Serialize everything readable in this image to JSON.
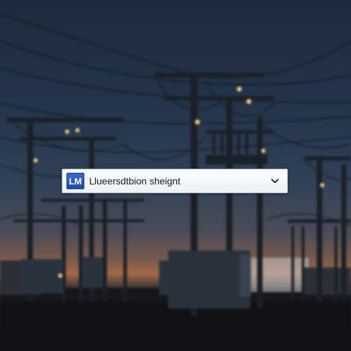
{
  "dropdown": {
    "badge_text": "LM",
    "selected_label": "Llueersdtbion sheignt",
    "chevron_icon": "chevron-down-icon",
    "accent_color": "#2b5cb8"
  },
  "background": {
    "description_icon": "power-substation-dusk-photo"
  }
}
